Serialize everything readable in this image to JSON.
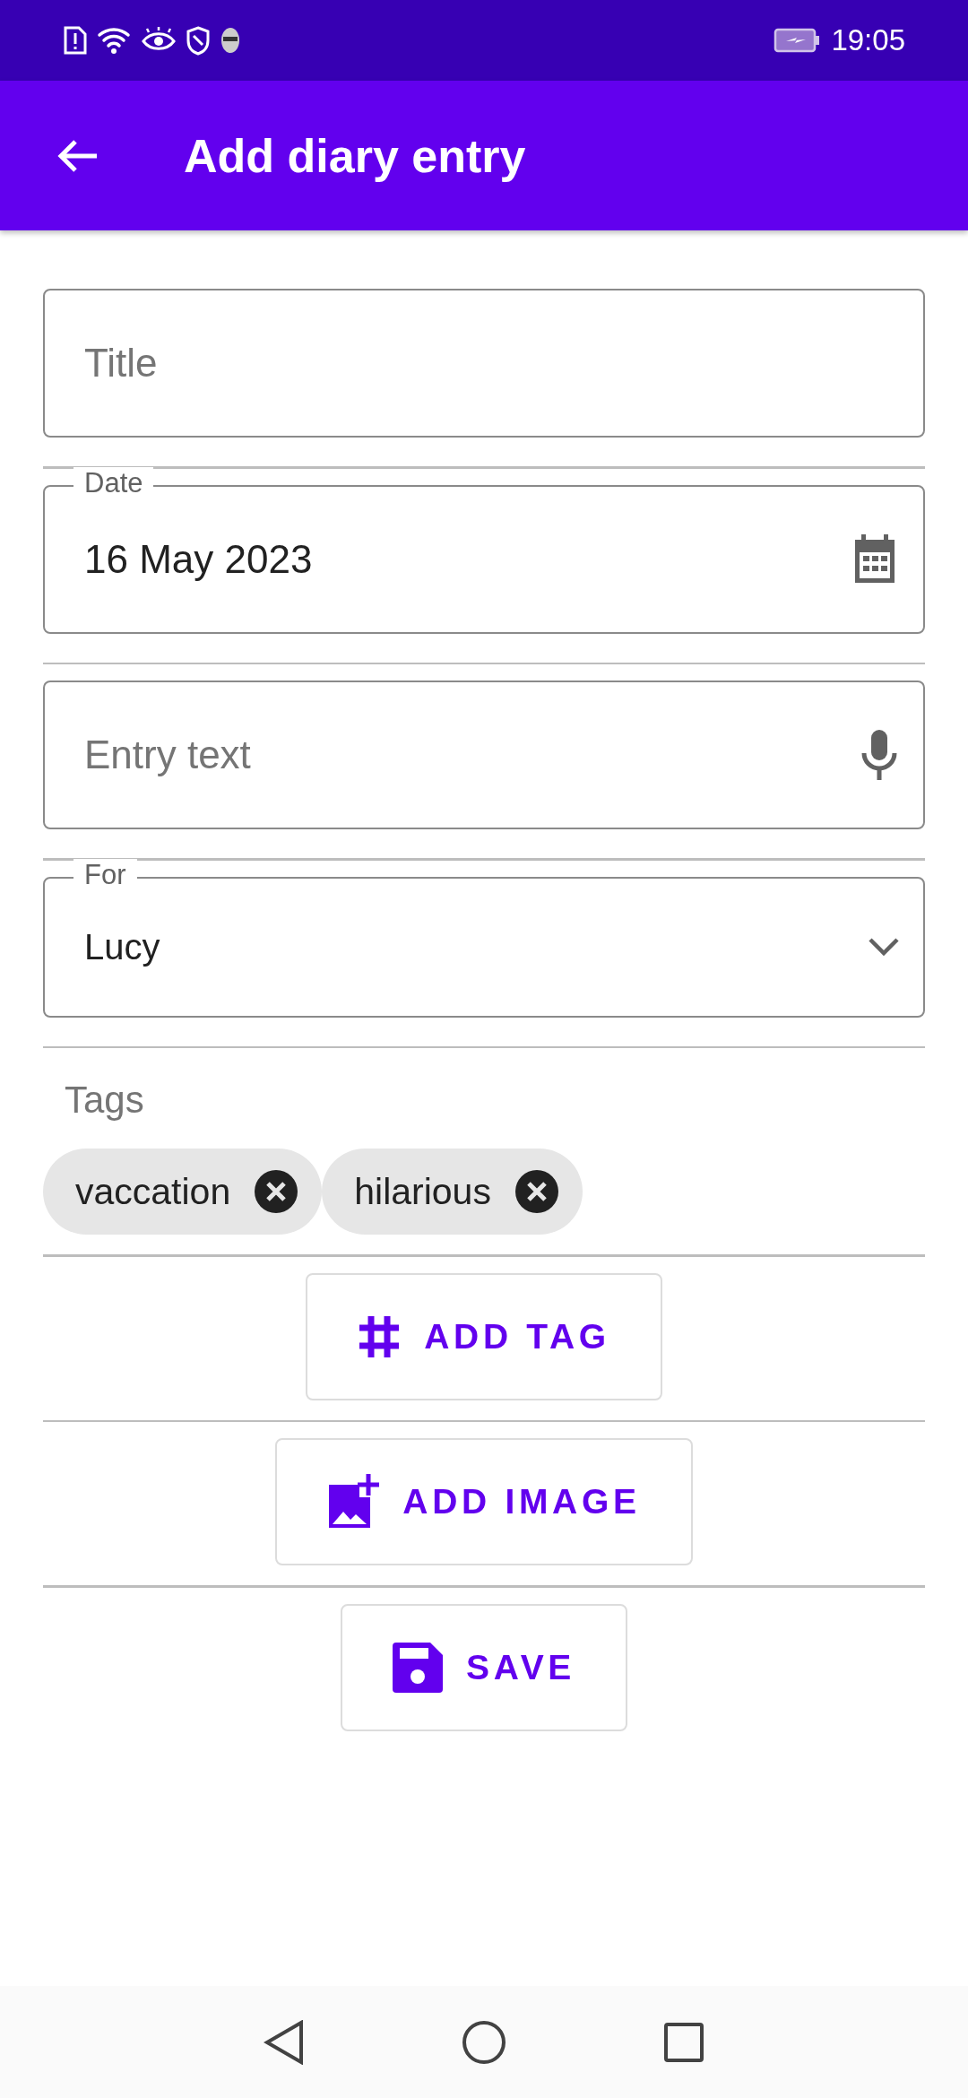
{
  "status_bar": {
    "time": "19:05"
  },
  "app_bar": {
    "title": "Add diary entry"
  },
  "fields": [
    {
      "kind": "text",
      "placeholder": "Title"
    },
    {
      "kind": "date",
      "label": "Date",
      "value": "16 May 2023"
    },
    {
      "kind": "voice",
      "placeholder": "Entry text"
    },
    {
      "kind": "dropdown",
      "label": "For",
      "value": "Lucy"
    }
  ],
  "tags": {
    "label": "Tags",
    "chips": [
      "vaccation",
      "hilarious"
    ]
  },
  "buttons": [
    {
      "kind": "tag",
      "label": "ADD TAG"
    },
    {
      "kind": "image",
      "label": "ADD IMAGE"
    },
    {
      "kind": "save",
      "label": "SAVE"
    }
  ]
}
